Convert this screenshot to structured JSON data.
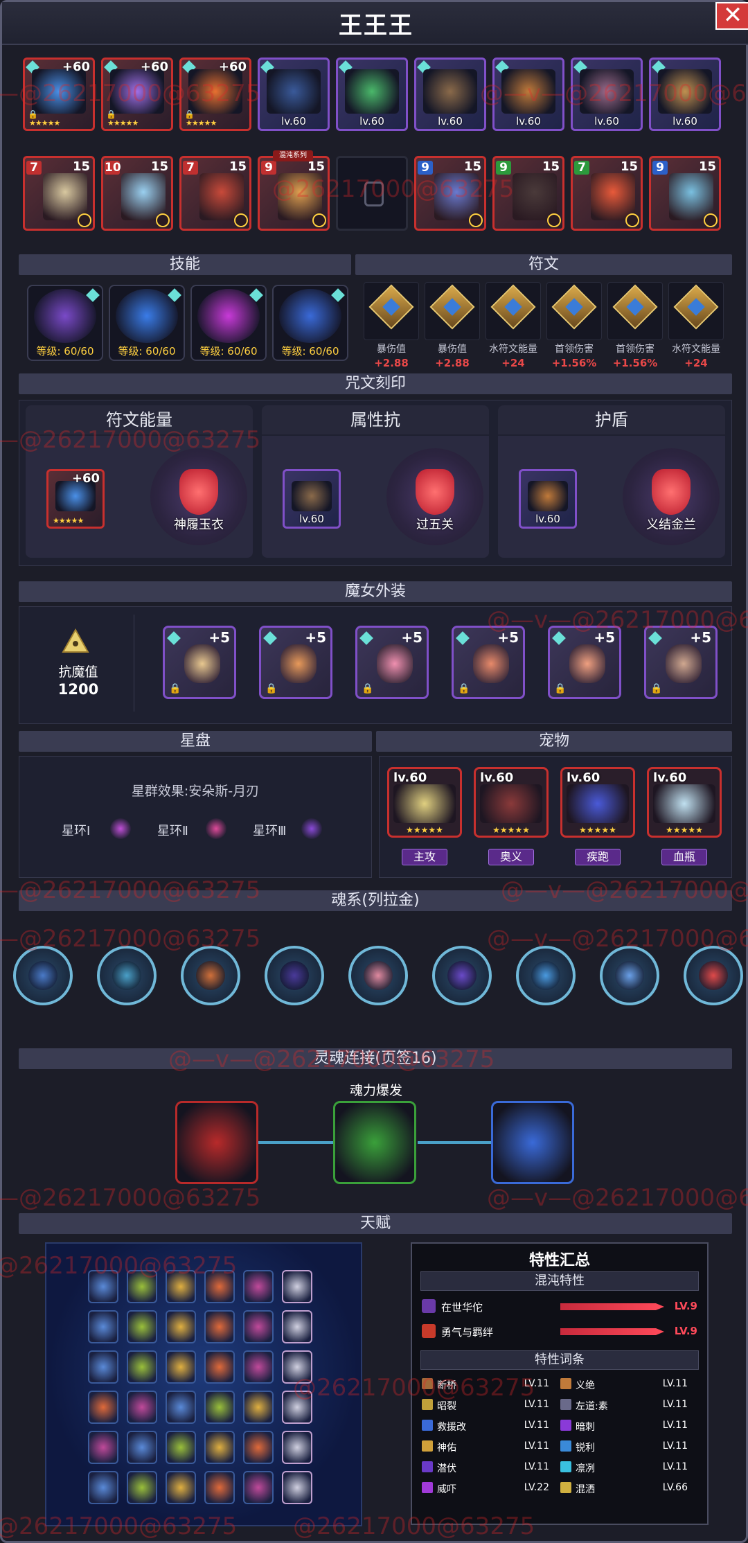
{
  "header": {
    "title": "王王王",
    "close_glyph": "✕"
  },
  "equip_top": [
    {
      "plus": "+60",
      "stars": "★★★★★",
      "color": "#4a90e8"
    },
    {
      "plus": "+60",
      "stars": "★★★★★",
      "color": "#a070e8"
    },
    {
      "plus": "+60",
      "stars": "★★★★★",
      "color": "#e87030"
    },
    {
      "level": "lv.60",
      "color": "#3a5a9a"
    },
    {
      "level": "lv.60",
      "color": "#4ab86a"
    },
    {
      "level": "lv.60",
      "color": "#8a6a4a"
    },
    {
      "level": "lv.60",
      "color": "#c07a3a"
    },
    {
      "level": "lv.60",
      "color": "#9a6a8a"
    },
    {
      "level": "lv.60",
      "color": "#c09050"
    }
  ],
  "heroes": [
    {
      "num": "7",
      "rank": "15",
      "color": "#d8c8a0"
    },
    {
      "num": "10",
      "rank": "15",
      "color": "#9ad0f0"
    },
    {
      "num": "7",
      "rank": "15",
      "color": "#c84a3a"
    },
    {
      "num": "9",
      "rank": "15",
      "color": "#e0a050",
      "tag": "混沌系列"
    },
    {
      "empty": true
    },
    {
      "num": "9",
      "rank": "15",
      "color": "#6a7ad0"
    },
    {
      "num": "9",
      "rank": "15",
      "color": "#4a3a3a"
    },
    {
      "num": "7",
      "rank": "15",
      "color": "#e85a3a"
    },
    {
      "num": "9",
      "rank": "15",
      "color": "#7ac0e0"
    }
  ],
  "sections": {
    "skills": "技能",
    "runes": "符文",
    "spell": "咒文刻印",
    "witch": "魔女外装",
    "star": "星盘",
    "pets": "宠物",
    "soul": "魂系(列拉金)",
    "link": "灵魂连接(页签16)",
    "talent": "天赋"
  },
  "skills": [
    {
      "level": "等级: 60/60",
      "color": "#7a4ac8"
    },
    {
      "level": "等级: 60/60",
      "color": "#3a7ce8"
    },
    {
      "level": "等级: 60/60",
      "color": "#c83ad8"
    },
    {
      "level": "等级: 60/60",
      "color": "#3a6ad8"
    }
  ],
  "runes": [
    {
      "name": "暴伤值",
      "value": "+2.88"
    },
    {
      "name": "暴伤值",
      "value": "+2.88"
    },
    {
      "name": "水符文能量",
      "value": "+24"
    },
    {
      "name": "首领伤害",
      "value": "+1.56%"
    },
    {
      "name": "首领伤害",
      "value": "+1.56%"
    },
    {
      "name": "水符文能量",
      "value": "+24"
    }
  ],
  "spell": [
    {
      "title": "符文能量",
      "plus": "+60",
      "stars": "★★★★★",
      "orb": "神履玉衣",
      "color": "#4a90e8"
    },
    {
      "title": "属性抗",
      "level": "lv.60",
      "orb": "过五关",
      "color": "#8a6a4a"
    },
    {
      "title": "护盾",
      "level": "lv.60",
      "orb": "义结金兰",
      "color": "#c07a3a"
    }
  ],
  "witch": {
    "stat_label": "抗魔值",
    "stat_value": "1200",
    "items": [
      {
        "plus": "+5",
        "color": "#e8c890"
      },
      {
        "plus": "+5",
        "color": "#e89a5a"
      },
      {
        "plus": "+5",
        "color": "#f090b0"
      },
      {
        "plus": "+5",
        "color": "#e88a6a"
      },
      {
        "plus": "+5",
        "color": "#f0a080"
      },
      {
        "plus": "+5",
        "color": "#d0a890"
      }
    ]
  },
  "star": {
    "effect": "星群效果:安朵斯-月刃",
    "rings": [
      {
        "label": "星环Ⅰ",
        "color": "#c050d8"
      },
      {
        "label": "星环Ⅱ",
        "color": "#e04a9a"
      },
      {
        "label": "星环Ⅲ",
        "color": "#8a4ad8"
      }
    ]
  },
  "pets": [
    {
      "level": "lv.60",
      "tag": "主攻",
      "color": "#e0d080"
    },
    {
      "level": "lv.60",
      "tag": "奥义",
      "color": "#8a3a3a"
    },
    {
      "level": "lv.60",
      "tag": "疾跑",
      "color": "#4a5ad8"
    },
    {
      "level": "lv.60",
      "tag": "血瓶",
      "color": "#c0e0f0"
    }
  ],
  "soul": [
    {
      "color": "#4a7ac8"
    },
    {
      "color": "#4aa0c8"
    },
    {
      "color": "#d0703a"
    },
    {
      "color": "#4a3a9a"
    },
    {
      "color": "#e08aa0"
    },
    {
      "color": "#6a4ac8"
    },
    {
      "color": "#4a9ae0"
    },
    {
      "color": "#6aa0e8"
    },
    {
      "color": "#e04a4a"
    }
  ],
  "link": {
    "label": "魂力爆发",
    "items": [
      {
        "color": "#b82a2a"
      },
      {
        "color": "#3aa03a"
      },
      {
        "color": "#3a6ad8"
      }
    ]
  },
  "talent_grid": {
    "colors": [
      "#5a8ad8",
      "#9ac03a",
      "#e0b040",
      "#e06a3a",
      "#c04a9a",
      "#d0d0e0"
    ]
  },
  "traits": {
    "title": "特性汇总",
    "chaos_hdr": "混沌特性",
    "chaos": [
      {
        "name": "在世华佗",
        "level": "LV.9",
        "color": "#6a3aa8"
      },
      {
        "name": "勇气与羁绊",
        "level": "LV.9",
        "color": "#c83a2a"
      }
    ],
    "entries_hdr": "特性词条",
    "entries": [
      {
        "name": "断桥",
        "level": "LV.11",
        "color": "#a06a3a"
      },
      {
        "name": "义绝",
        "level": "LV.11",
        "color": "#c07a3a"
      },
      {
        "name": "昭裂",
        "level": "LV.11",
        "color": "#c0a03a"
      },
      {
        "name": "左道:素",
        "level": "LV.11",
        "color": "#6a6a8a"
      },
      {
        "name": "救援改",
        "level": "LV.11",
        "color": "#3a6ad8"
      },
      {
        "name": "暗刺",
        "level": "LV.11",
        "color": "#8a3ad8"
      },
      {
        "name": "神佑",
        "level": "LV.11",
        "color": "#d0a03a"
      },
      {
        "name": "锐利",
        "level": "LV.11",
        "color": "#3a8ad8"
      },
      {
        "name": "潜伏",
        "level": "LV.11",
        "color": "#6a3ac8"
      },
      {
        "name": "凛冽",
        "level": "LV.11",
        "color": "#3ac0e0"
      },
      {
        "name": "威吓",
        "level": "LV.22",
        "color": "#a03ad8"
      },
      {
        "name": "混洒",
        "level": "LV.66",
        "color": "#d0b040"
      }
    ]
  },
  "watermarks": {
    "a": "@—v—@26217000@63275",
    "b": "—@26217000@63275",
    "c": "@26217000@63275"
  }
}
